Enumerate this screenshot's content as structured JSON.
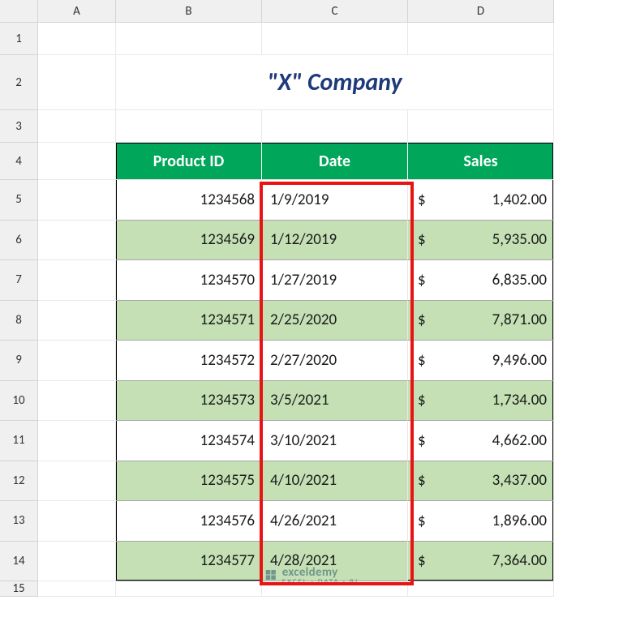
{
  "columns": [
    "A",
    "B",
    "C",
    "D"
  ],
  "rows": [
    "1",
    "2",
    "3",
    "4",
    "5",
    "6",
    "7",
    "8",
    "9",
    "10",
    "11",
    "12",
    "13",
    "14",
    "15"
  ],
  "title": "\"X\" Company",
  "headers": {
    "product_id": "Product ID",
    "date": "Date",
    "sales": "Sales"
  },
  "currency": "$",
  "table": [
    {
      "product_id": "1234568",
      "date": "1/9/2019",
      "sales": "1,402.00"
    },
    {
      "product_id": "1234569",
      "date": "1/12/2019",
      "sales": "5,935.00"
    },
    {
      "product_id": "1234570",
      "date": "1/27/2019",
      "sales": "6,835.00"
    },
    {
      "product_id": "1234571",
      "date": "2/25/2020",
      "sales": "7,871.00"
    },
    {
      "product_id": "1234572",
      "date": "2/27/2020",
      "sales": "9,496.00"
    },
    {
      "product_id": "1234573",
      "date": "3/5/2021",
      "sales": "1,734.00"
    },
    {
      "product_id": "1234574",
      "date": "3/10/2021",
      "sales": "4,662.00"
    },
    {
      "product_id": "1234575",
      "date": "4/10/2021",
      "sales": "3,437.00"
    },
    {
      "product_id": "1234576",
      "date": "4/26/2021",
      "sales": "1,896.00"
    },
    {
      "product_id": "1234577",
      "date": "4/28/2021",
      "sales": "7,364.00"
    }
  ],
  "watermark": {
    "brand": "exceldemy",
    "tag": "EXCEL · DATA · BI"
  }
}
